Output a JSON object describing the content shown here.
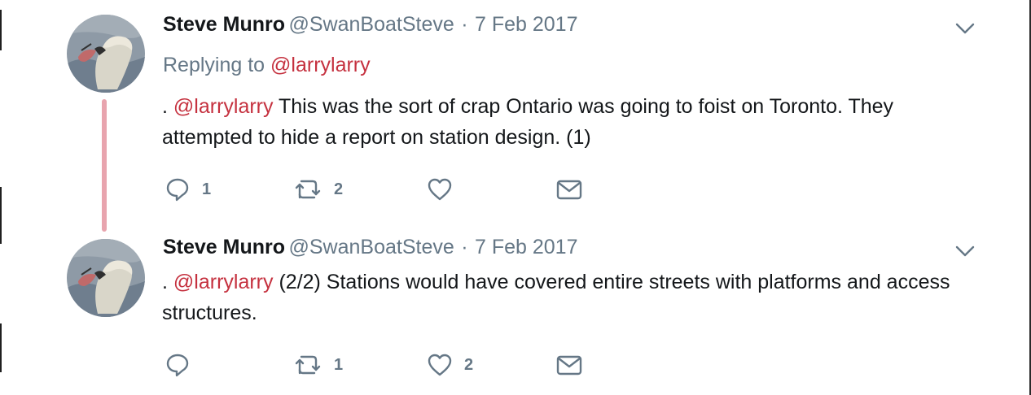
{
  "colors": {
    "accent_mention": "#c5313f",
    "muted": "#657786",
    "thread_line": "#e8a4ae",
    "text": "#14171a"
  },
  "tweets": [
    {
      "author_name": "Steve Munro",
      "author_handle": "@SwanBoatSteve",
      "separator": "·",
      "date": "7 Feb 2017",
      "replying_prefix": "Replying to",
      "replying_to": "@larrylarry",
      "text_prefix": ". ",
      "text_mention": "@larrylarry",
      "text_body": " This was the sort of crap Ontario was going to foist on Toronto. They attempted to hide a report on station design. (1)",
      "reply_count": "1",
      "retweet_count": "2",
      "like_count": "",
      "icons": {
        "reply": "reply-icon",
        "retweet": "retweet-icon",
        "like": "heart-icon",
        "dm": "envelope-icon",
        "menu": "chevron-down-icon",
        "avatar": "swan-avatar"
      }
    },
    {
      "author_name": "Steve Munro",
      "author_handle": "@SwanBoatSteve",
      "separator": "·",
      "date": "7 Feb 2017",
      "text_prefix": ". ",
      "text_mention": "@larrylarry",
      "text_body": " (2/2) Stations would have covered entire streets with platforms and access structures.",
      "reply_count": "",
      "retweet_count": "1",
      "like_count": "2",
      "icons": {
        "reply": "reply-icon",
        "retweet": "retweet-icon",
        "like": "heart-icon",
        "dm": "envelope-icon",
        "menu": "chevron-down-icon",
        "avatar": "swan-avatar"
      }
    }
  ]
}
